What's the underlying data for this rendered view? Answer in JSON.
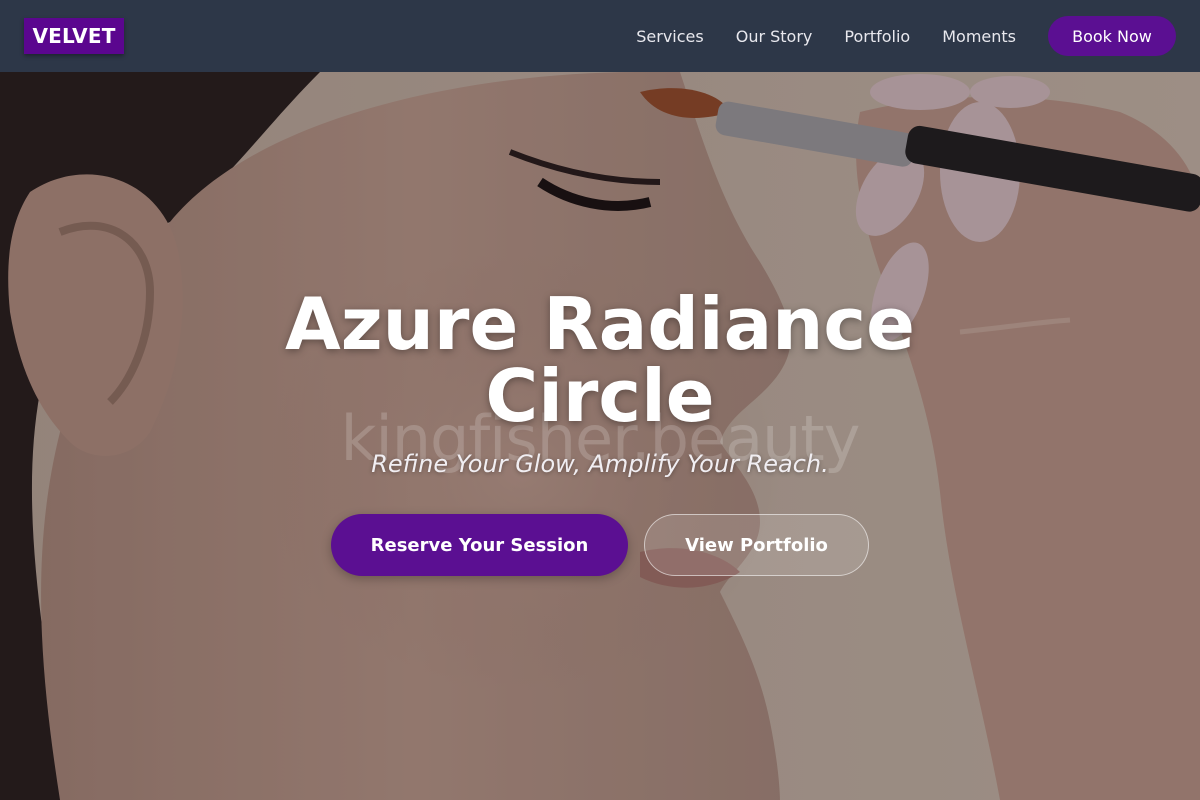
{
  "brand": {
    "logo_text": "VELVET",
    "accent_color": "#5b068f"
  },
  "nav": {
    "items": [
      {
        "label": "Services"
      },
      {
        "label": "Our Story"
      },
      {
        "label": "Portfolio"
      },
      {
        "label": "Moments"
      }
    ],
    "cta_label": "Book Now"
  },
  "hero": {
    "title_line1": "Azure Radiance",
    "title_line2": "Circle",
    "watermark": "kingfisher.beauty",
    "tagline": "Refine Your Glow, Amplify Your Reach.",
    "primary_cta": "Reserve Your Session",
    "secondary_cta": "View Portfolio",
    "background_image": "makeup-brush-on-face-photo"
  },
  "colors": {
    "header_bg": "#2d3748",
    "button_purple": "#5b0f92"
  }
}
